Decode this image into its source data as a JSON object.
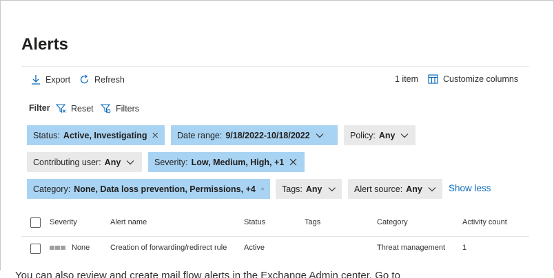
{
  "page": {
    "title": "Alerts"
  },
  "toolbar": {
    "export_label": "Export",
    "refresh_label": "Refresh",
    "item_count": "1 item",
    "customize_label": "Customize columns"
  },
  "filter": {
    "label": "Filter",
    "reset_label": "Reset",
    "filters_label": "Filters",
    "pills": [
      {
        "label": "Status:",
        "value": "Active, Investigating",
        "active": true,
        "control": "close"
      },
      {
        "label": "Date range:",
        "value": "9/18/2022-10/18/2022",
        "active": true,
        "control": "chevron"
      },
      {
        "label": "Policy:",
        "value": "Any",
        "active": false,
        "control": "chevron"
      },
      {
        "label": "Contributing user:",
        "value": "Any",
        "active": false,
        "control": "chevron"
      },
      {
        "label": "Severity:",
        "value": "Low, Medium, High, +1",
        "active": true,
        "control": "close"
      },
      {
        "label": "Category:",
        "value": "None, Data loss prevention, Permissions, +4",
        "active": true,
        "control": "close"
      },
      {
        "label": "Tags:",
        "value": "Any",
        "active": false,
        "control": "chevron"
      },
      {
        "label": "Alert source:",
        "value": "Any",
        "active": false,
        "control": "chevron"
      }
    ],
    "show_less_label": "Show less"
  },
  "table": {
    "columns": [
      "Severity",
      "Alert name",
      "Status",
      "Tags",
      "Category",
      "Activity count"
    ],
    "rows": [
      {
        "severity": "None",
        "alert_name": "Creation of forwarding/redirect rule",
        "status": "Active",
        "tags": "",
        "category": "Threat management",
        "activity_count": "1"
      }
    ]
  },
  "footer_text": "You can also review and create mail flow alerts in the Exchange Admin center. Go to",
  "colors": {
    "active_pill": "#a9d3f2",
    "inactive_pill": "#e9e9e9",
    "link": "#0f6cbd",
    "icon": "#0f6cbd"
  }
}
